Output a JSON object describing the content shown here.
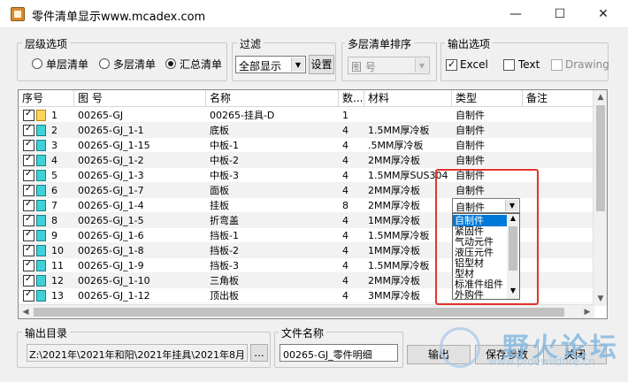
{
  "window": {
    "title": "零件清单显示www.mcadex.com",
    "minimize": "—",
    "maximize": "☐",
    "close": "✕"
  },
  "level": {
    "label": "层级选项",
    "options": [
      "单层清单",
      "多层清单",
      "汇总清单"
    ],
    "selected": 2
  },
  "filter": {
    "label": "过滤",
    "value": "全部显示",
    "set_button": "设置"
  },
  "sort": {
    "label": "多层清单排序",
    "value": "图 号"
  },
  "output": {
    "label": "输出选项",
    "excel": "Excel",
    "text": "Text",
    "drawing": "Drawing"
  },
  "table": {
    "headers": [
      "序号",
      "图 号",
      "名称",
      "数...",
      "材料",
      "类型",
      "备注"
    ],
    "rows": [
      {
        "no": "1",
        "code": "00265-GJ",
        "name": "00265-挂具-D",
        "qty": "1",
        "material": "",
        "type": "自制件"
      },
      {
        "no": "2",
        "code": "00265-GJ_1-1",
        "name": "底板",
        "qty": "4",
        "material": "1.5MM厚冷板",
        "type": "自制件"
      },
      {
        "no": "3",
        "code": "00265-GJ_1-15",
        "name": "中板-1",
        "qty": "4",
        "material": ".5MM厚冷板",
        "type": "自制件"
      },
      {
        "no": "4",
        "code": "00265-GJ_1-2",
        "name": "中板-2",
        "qty": "4",
        "material": "2MM厚冷板",
        "type": "自制件"
      },
      {
        "no": "5",
        "code": "00265-GJ_1-3",
        "name": "中板-3",
        "qty": "4",
        "material": "1.5MM厚SUS304",
        "type": "自制件"
      },
      {
        "no": "6",
        "code": "00265-GJ_1-7",
        "name": "面板",
        "qty": "4",
        "material": "2MM厚冷板",
        "type": "自制件"
      },
      {
        "no": "7",
        "code": "00265-GJ_1-4",
        "name": "挂板",
        "qty": "8",
        "material": "2MM厚冷板",
        "type": "自制件"
      },
      {
        "no": "8",
        "code": "00265-GJ_1-5",
        "name": "折弯盖",
        "qty": "4",
        "material": "1MM厚冷板",
        "type": ""
      },
      {
        "no": "9",
        "code": "00265-GJ_1-6",
        "name": "挡板-1",
        "qty": "4",
        "material": "1.5MM厚冷板",
        "type": ""
      },
      {
        "no": "10",
        "code": "00265-GJ_1-8",
        "name": "挡板-2",
        "qty": "4",
        "material": "1MM厚冷板",
        "type": ""
      },
      {
        "no": "11",
        "code": "00265-GJ_1-9",
        "name": "挡板-3",
        "qty": "4",
        "material": "1.5MM厚冷板",
        "type": ""
      },
      {
        "no": "12",
        "code": "00265-GJ_1-10",
        "name": "三角板",
        "qty": "4",
        "material": "2MM厚冷板",
        "type": ""
      },
      {
        "no": "13",
        "code": "00265-GJ_1-12",
        "name": "顶出板",
        "qty": "4",
        "material": "3MM厚冷板",
        "type": ""
      }
    ],
    "editing_value": "自制件",
    "dropdown_options": [
      "自制件",
      "紧固件",
      "气动元件",
      "液压元件",
      "铝型材",
      "型材",
      "标准件组件",
      "外购件"
    ]
  },
  "bottom": {
    "outdir_label": "输出目录",
    "outdir_value": "Z:\\2021年\\2021年和阳\\2021年挂具\\2021年8月:",
    "browse": "...",
    "filename_label": "文件名称",
    "filename_value": "00265-GJ_零件明细",
    "export_button": "输出",
    "save_button": "保存参数",
    "close_button": "关闭"
  },
  "watermark": {
    "text": "野火论坛",
    "url": "www.proewildfire.cn"
  }
}
